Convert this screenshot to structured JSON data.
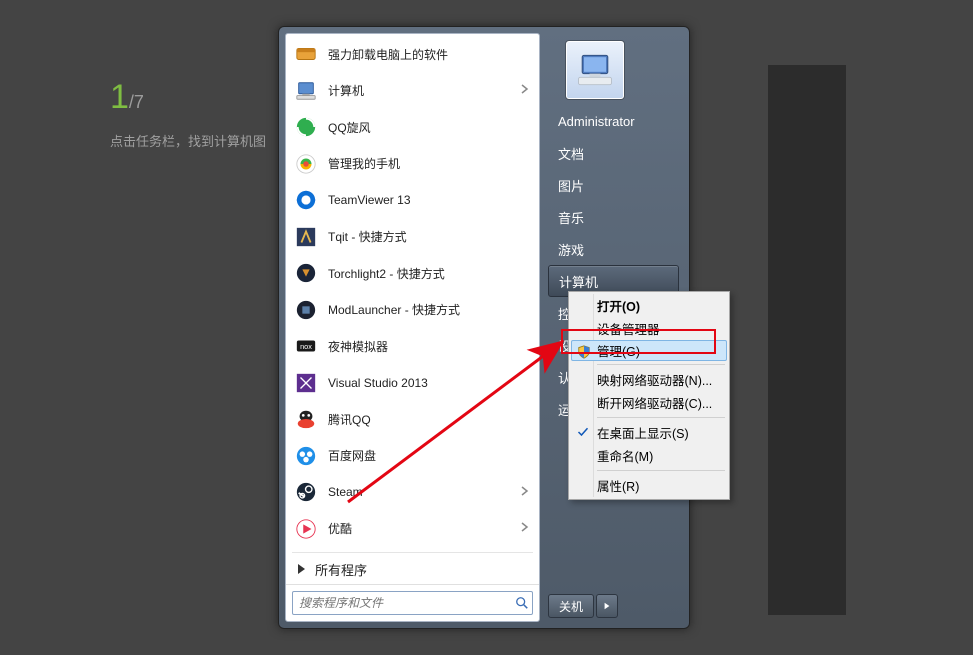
{
  "page": {
    "current": "1",
    "total": "/7",
    "desc": "点击任务栏，找到计算机图"
  },
  "start_menu": {
    "items": [
      {
        "label": "强力卸载电脑上的软件"
      },
      {
        "label": "计算机"
      },
      {
        "label": "QQ旋风"
      },
      {
        "label": "管理我的手机"
      },
      {
        "label": "TeamViewer 13"
      },
      {
        "label": "Tqit - 快捷方式"
      },
      {
        "label": "Torchlight2 - 快捷方式"
      },
      {
        "label": "ModLauncher - 快捷方式"
      },
      {
        "label": "夜神模拟器"
      },
      {
        "label": "Visual Studio 2013"
      },
      {
        "label": "腾讯QQ"
      },
      {
        "label": "百度网盘"
      },
      {
        "label": "Steam"
      },
      {
        "label": "优酷"
      }
    ],
    "all_programs": "所有程序",
    "search_placeholder": "搜索程序和文件",
    "right": {
      "user": "Administrator",
      "items": [
        "文档",
        "图片",
        "音乐",
        "游戏",
        "计算机",
        "控制",
        "设备",
        "认",
        "运行"
      ],
      "hl_index": 4,
      "shutdown": "关机"
    }
  },
  "context_menu": {
    "items": [
      {
        "label": "打开(O)",
        "bold": true
      },
      {
        "label": "设备管理器"
      },
      {
        "label": "管理(G)",
        "hl": true,
        "shield": true
      },
      {
        "sep": true
      },
      {
        "label": "映射网络驱动器(N)..."
      },
      {
        "label": "断开网络驱动器(C)..."
      },
      {
        "sep": true
      },
      {
        "label": "在桌面上显示(S)",
        "check": true
      },
      {
        "label": "重命名(M)"
      },
      {
        "sep": true
      },
      {
        "label": "属性(R)"
      }
    ]
  }
}
